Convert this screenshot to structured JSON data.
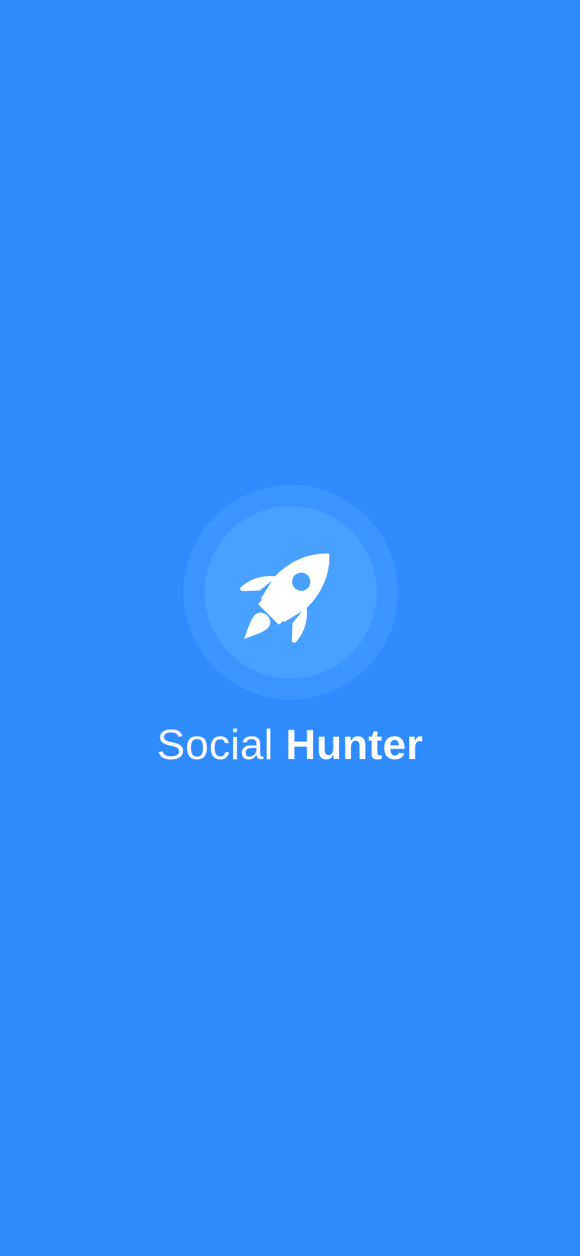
{
  "app": {
    "name_light": "Social",
    "name_bold": "Hunter"
  },
  "logo": {
    "icon": "rocket-icon"
  },
  "colors": {
    "background": "#2e8cff",
    "outer_circle": "#3b95ff",
    "inner_circle": "#49a1ff",
    "foreground": "#ffffff"
  }
}
